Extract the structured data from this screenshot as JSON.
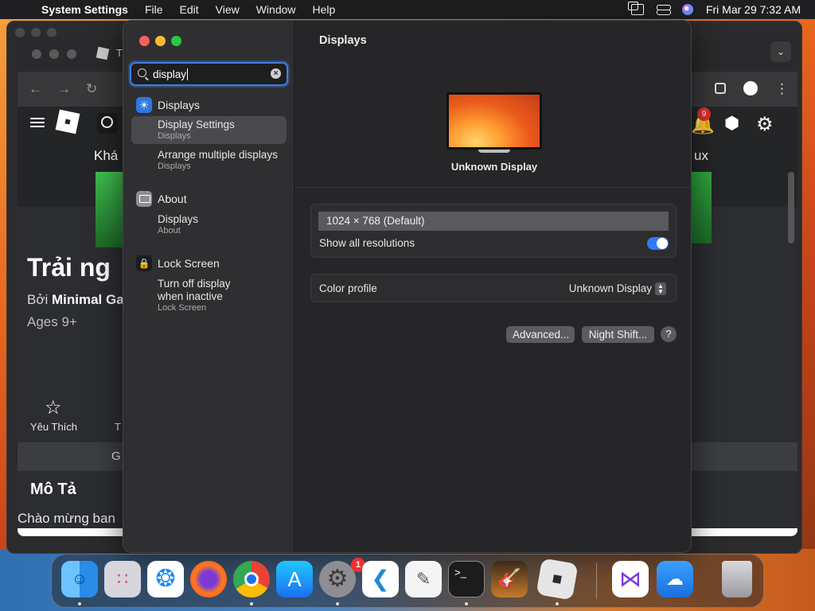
{
  "menubar": {
    "app_name": "System Settings",
    "menus": [
      "File",
      "Edit",
      "View",
      "Window",
      "Help"
    ],
    "datetime": "Fri Mar 29  7:32 AM"
  },
  "background_browser": {
    "tab_title": "T",
    "notification_count": "9",
    "header_tab_left": "Khá",
    "header_tab_right": "ux",
    "game_title": "Trải ng",
    "byline_prefix": "Bởi ",
    "byline_creator": "Minimal Ga",
    "ages": "Ages 9+",
    "favorite_label": "Yêu Thích",
    "second_action_label": "T",
    "tab_bar_text": "G",
    "description_heading": "Mô Tả",
    "description_text": "Chào mừng ban"
  },
  "settings": {
    "search": {
      "value": "display",
      "placeholder": "Search"
    },
    "results": [
      {
        "section": "Displays",
        "items": [
          {
            "title": "Display Settings",
            "subtitle": "Displays",
            "selected": true
          },
          {
            "title": "Arrange multiple displays",
            "subtitle": "Displays",
            "selected": false
          }
        ]
      },
      {
        "section": "About",
        "items": [
          {
            "title": "Displays",
            "subtitle": "About",
            "selected": false
          }
        ]
      },
      {
        "section": "Lock Screen",
        "items": [
          {
            "title": "Turn off display",
            "title2": "when inactive",
            "subtitle": "Lock Screen",
            "selected": false
          }
        ]
      }
    ],
    "pane": {
      "title": "Displays",
      "display_name": "Unknown Display",
      "resolution": "1024 × 768 (Default)",
      "show_all_label": "Show all resolutions",
      "show_all_on": true,
      "color_profile_label": "Color profile",
      "color_profile_value": "Unknown Display",
      "advanced_button": "Advanced...",
      "night_shift_button": "Night Shift...",
      "help_button": "?"
    }
  },
  "dock": {
    "apps": [
      "Finder",
      "Launchpad",
      "Safari",
      "Firefox",
      "Chrome",
      "App Store",
      "System Settings",
      "Visual Studio Code",
      "TextEdit",
      "Terminal",
      "GarageBand",
      "Roblox",
      "Visual Studio",
      "Weather",
      "Trash"
    ],
    "system_settings_badge": "1"
  },
  "colors": {
    "accent": "#2f7bf5",
    "window_bg": "#262629",
    "sidebar_bg": "#2f2f32",
    "badge_red": "#f0312b"
  }
}
